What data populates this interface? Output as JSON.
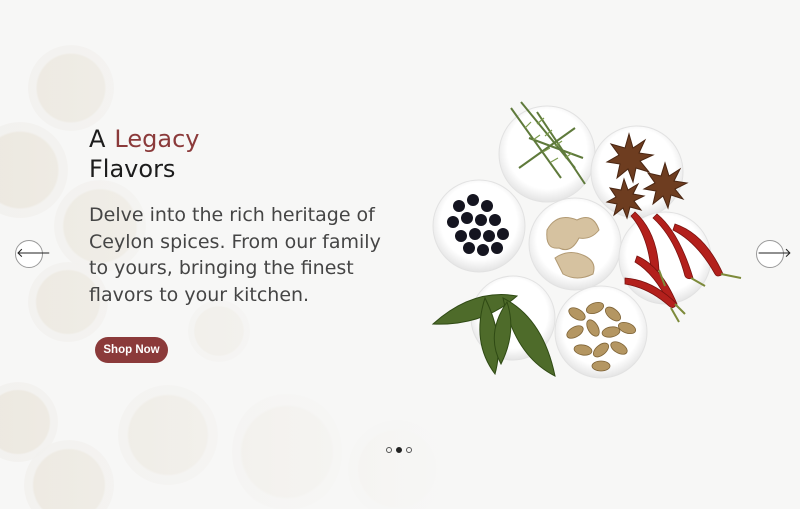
{
  "hero": {
    "title_prefix": "A",
    "title_accent": "Legacy",
    "title_line2": "Flavors",
    "description": "Delve into the rich heritage of Ceylon spices. From our family to yours, bringing the finest flavors to your kitchen.",
    "cta_label": "Shop Now"
  },
  "carousel": {
    "prev_icon": "arrow-left-icon",
    "next_icon": "arrow-right-icon",
    "prev_glyph": "🡐",
    "next_glyph": "🡒",
    "slides_count": 3,
    "active_slide": 2
  },
  "colors": {
    "accent": "#8b3a3a",
    "text": "#1c1c1c",
    "background": "#f7f7f6"
  }
}
